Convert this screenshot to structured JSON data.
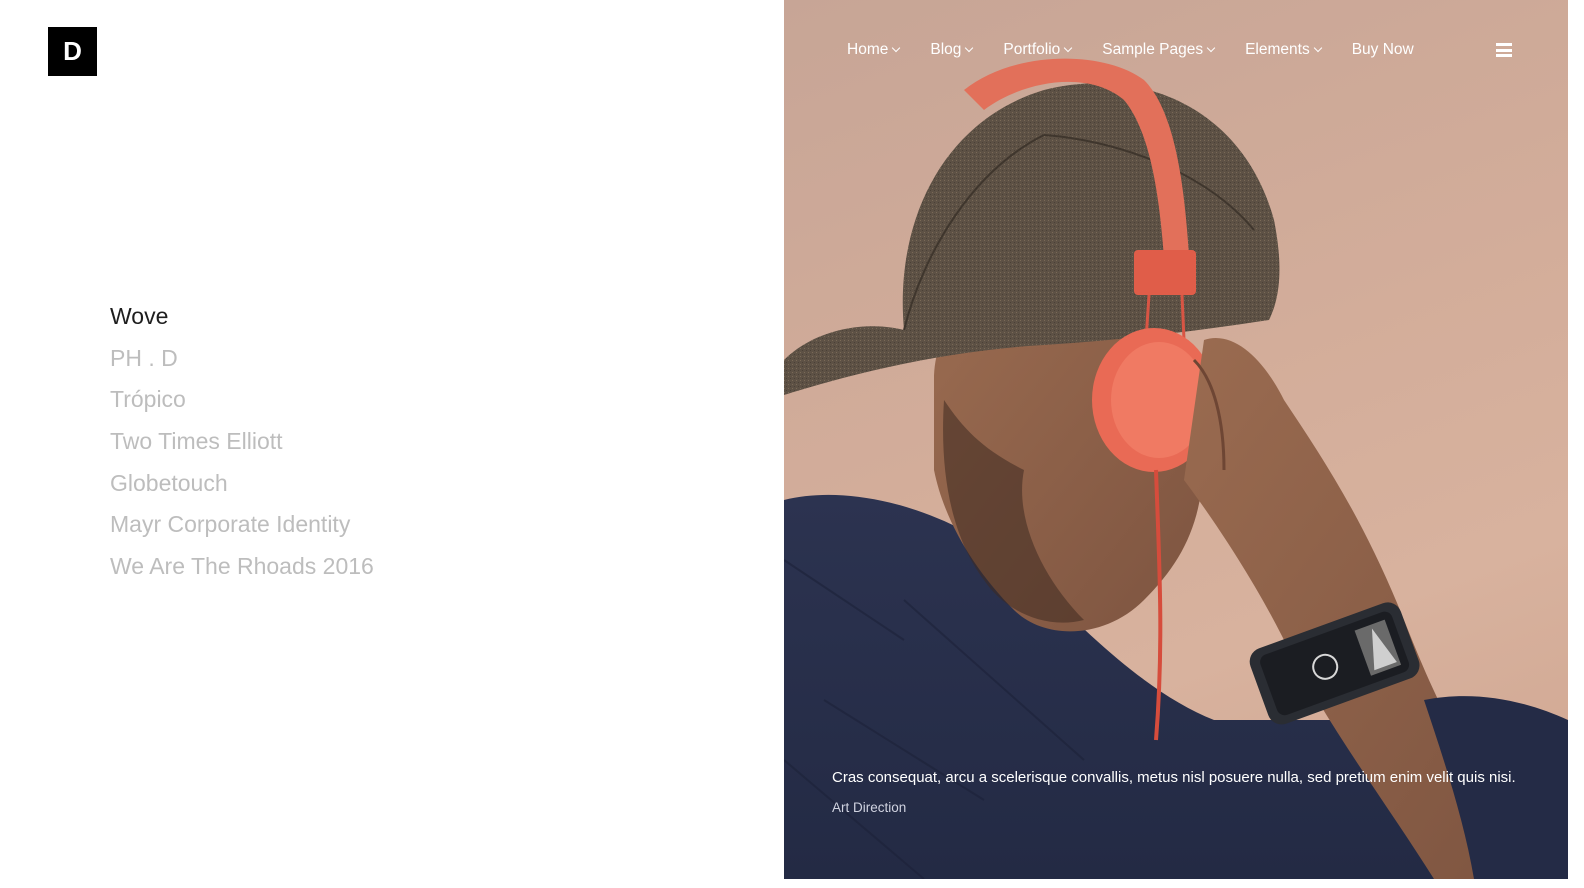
{
  "brand": {
    "logo_letter": "D"
  },
  "projects": {
    "items": [
      {
        "label": "Wove",
        "active": true
      },
      {
        "label": "PH . D",
        "active": false
      },
      {
        "label": "Trópico",
        "active": false
      },
      {
        "label": "Two Times Elliott",
        "active": false
      },
      {
        "label": "Globetouch",
        "active": false
      },
      {
        "label": "Mayr Corporate Identity",
        "active": false
      },
      {
        "label": "We Are The Rhoads 2016",
        "active": false
      }
    ]
  },
  "nav": {
    "items": [
      {
        "label": "Home",
        "dropdown": true
      },
      {
        "label": "Blog",
        "dropdown": true
      },
      {
        "label": "Portfolio",
        "dropdown": true
      },
      {
        "label": "Sample Pages",
        "dropdown": true
      },
      {
        "label": "Elements",
        "dropdown": true
      },
      {
        "label": "Buy Now",
        "dropdown": false
      }
    ],
    "menu_icon": "hamburger-menu-icon"
  },
  "feature": {
    "caption": "Cras consequat, arcu a scelerisque convallis, metus nisl posuere nulla, sed pretium enim velit quis nisi.",
    "category": "Art Direction"
  },
  "colors": {
    "logo_bg": "#000000",
    "active_item": "#1e1e1e",
    "inactive_item": "#bdbdbd",
    "hero_bg": "#d3ad9a",
    "nav_text": "#ffffff"
  }
}
